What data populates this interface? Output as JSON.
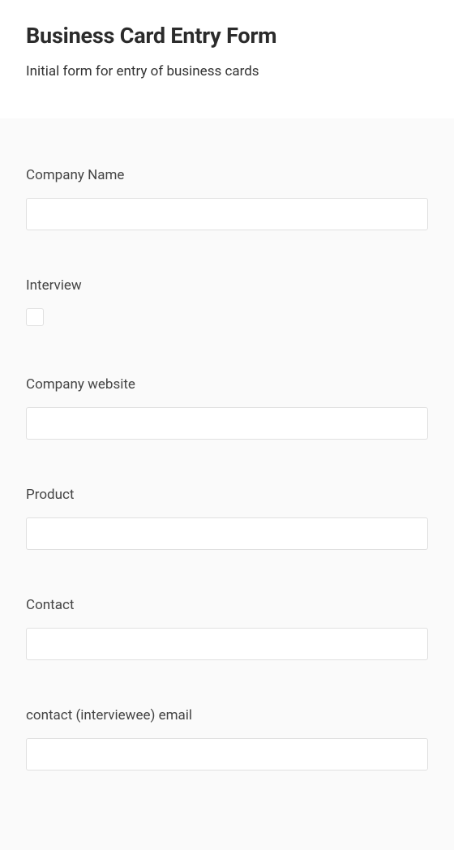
{
  "header": {
    "title": "Business Card Entry Form",
    "subtitle": "Initial form for entry of business cards"
  },
  "fields": {
    "company_name": {
      "label": "Company Name",
      "value": ""
    },
    "interview": {
      "label": "Interview",
      "checked": false
    },
    "company_website": {
      "label": "Company website",
      "value": ""
    },
    "product": {
      "label": "Product",
      "value": ""
    },
    "contact": {
      "label": "Contact",
      "value": ""
    },
    "contact_email": {
      "label": "contact (interviewee) email",
      "value": ""
    }
  }
}
